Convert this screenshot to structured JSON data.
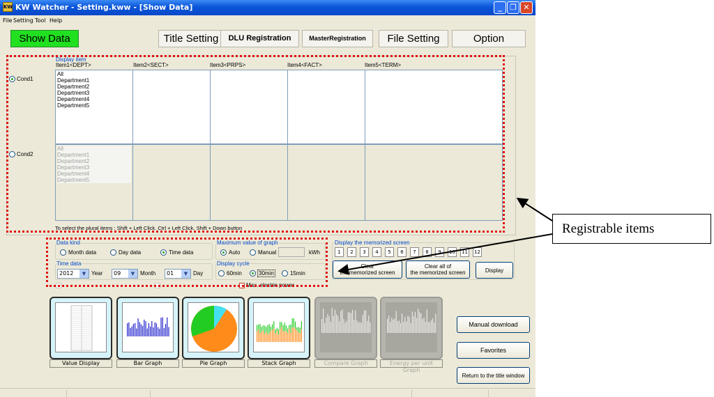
{
  "window": {
    "title": "KW Watcher - Setting.kww - [Show Data]",
    "app_icon": "KW"
  },
  "menu": [
    "File",
    "Setting",
    "Tool",
    "Help"
  ],
  "toolbar": {
    "show_data": "Show Data",
    "title_setting": "Title Setting",
    "dlu": "DLU Registration",
    "master": "MasterRegistration",
    "file_setting": "File Setting",
    "option": "Option"
  },
  "display_item": {
    "label": "Display item",
    "columns": [
      "Item1<DEPT>",
      "Item2<SECT>",
      "Item3<PRPS>",
      "Item4<FACT>",
      "Item5<TERM>"
    ],
    "cond1": "Cond1",
    "cond2": "Cond2",
    "list": [
      "All",
      "Department1",
      "Department2",
      "Department3",
      "Department4",
      "Department5"
    ],
    "hint": "To select the plural items : Shift + Left Click. Ctrl + Left Click. Shift + Down button"
  },
  "data_kind": {
    "label": "Data kind",
    "month": "Month data",
    "day": "Day data",
    "time": "Time data",
    "selected": "time"
  },
  "time_data": {
    "label": "Time data",
    "year": "2012",
    "year_lbl": "Year",
    "month": "09",
    "month_lbl": "Month",
    "day": "01",
    "day_lbl": "Day"
  },
  "max_graph": {
    "label": "Maximum value of graph",
    "auto": "Auto",
    "manual": "Manual",
    "unit": "kWh",
    "selected": "auto"
  },
  "display_cycle": {
    "label": "Display cycle",
    "c60": "60min",
    "c30": "30min",
    "c15": "15min",
    "selected": "30min"
  },
  "under_options": {
    "max_power": "Max. electric power"
  },
  "memorized": {
    "label": "Display the memorized screen",
    "numbers": [
      "1",
      "2",
      "3",
      "4",
      "5",
      "6",
      "7",
      "8",
      "9",
      "10",
      "11",
      "12"
    ],
    "clear_l1": "Clear",
    "clear_l2": "the memorized screen",
    "clear_all_l1": "Clear all of",
    "clear_all_l2": "the memorized screen",
    "display": "Display"
  },
  "graphs": [
    {
      "label": "Value Display",
      "enabled": true
    },
    {
      "label": "Bar Graph",
      "enabled": true
    },
    {
      "label": "Pie Graph",
      "enabled": true
    },
    {
      "label": "Stack Graph",
      "enabled": true
    },
    {
      "label": "Compare Graph",
      "enabled": false
    },
    {
      "label": "Energy per unit Graph",
      "enabled": false
    }
  ],
  "right_buttons": {
    "manual_download": "Manual download",
    "favorites": "Favorites",
    "return": "Return to the title window"
  },
  "annotation": {
    "text": "Registrable items"
  },
  "colors": {
    "titlebar": "#0a55d8",
    "show_data_bg": "#20e020",
    "highlight_dots": "#e01010",
    "pie_green": "#22cc22",
    "pie_orange": "#ff8c1a",
    "pie_cyan": "#44e0f0",
    "bar_blue": "#2222cc"
  }
}
